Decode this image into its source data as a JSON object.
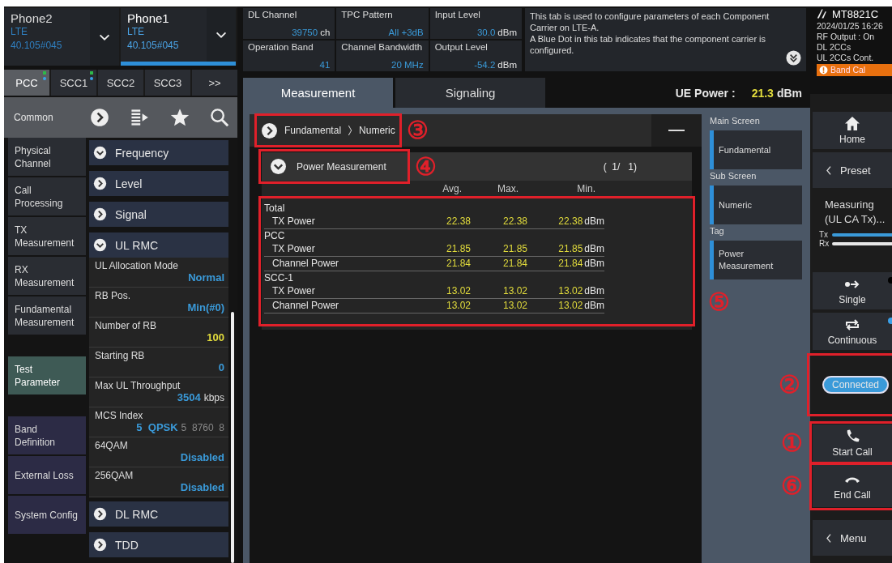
{
  "phones": [
    {
      "name": "Phone2",
      "standard": "LTE",
      "version": "40.105#045",
      "selected": false
    },
    {
      "name": "Phone1",
      "standard": "LTE",
      "version": "40.105#045",
      "selected": true
    }
  ],
  "carrier_tabs": [
    {
      "label": "PCC",
      "selected": true,
      "configured": true,
      "active": true
    },
    {
      "label": "SCC1",
      "selected": false,
      "configured": true,
      "active": true
    },
    {
      "label": "SCC2",
      "selected": false,
      "configured": false,
      "active": false
    },
    {
      "label": "SCC3",
      "selected": false,
      "configured": false,
      "active": false
    },
    {
      "label": ">>",
      "selected": false,
      "configured": false,
      "active": false
    }
  ],
  "header_params": [
    {
      "label": "DL Channel",
      "value": "39750",
      "unit": "ch"
    },
    {
      "label": "TPC Pattern",
      "value": "All +3dB"
    },
    {
      "label": "Input Level",
      "value": "30.0",
      "unit": "dBm"
    },
    {
      "label": "Operation Band",
      "value": "41"
    },
    {
      "label": "Channel Bandwidth",
      "value": "20 MHz"
    },
    {
      "label": "Output Level",
      "value": "-54.2",
      "unit": "dBm"
    }
  ],
  "help_text": [
    "This tab is used to configure parameters of each Component Carrier on LTE-A.",
    "A Blue Dot in this tab indicates that the component carrier is configured."
  ],
  "common": {
    "label": "Common"
  },
  "nav": [
    {
      "label": "Physical Channel",
      "kind": "main",
      "selected": false
    },
    {
      "label": "Call Processing",
      "kind": "main",
      "selected": false
    },
    {
      "label": "TX Measurement",
      "kind": "main",
      "selected": false
    },
    {
      "label": "RX Measurement",
      "kind": "main",
      "selected": false
    },
    {
      "label": "Fundamental Measurement",
      "kind": "main",
      "selected": false
    },
    {
      "label": "Test Parameter",
      "kind": "test",
      "selected": true
    },
    {
      "label": "Band Definition",
      "kind": "system",
      "selected": false
    },
    {
      "label": "External Loss",
      "kind": "system",
      "selected": false
    },
    {
      "label": "System Config",
      "kind": "system",
      "selected": false
    }
  ],
  "sections": [
    {
      "title": "Frequency",
      "expanded": true
    },
    {
      "title": "Level",
      "expanded": false
    },
    {
      "title": "Signal",
      "expanded": false
    },
    {
      "title": "UL RMC",
      "expanded": true,
      "rows": [
        {
          "label": "UL Allocation Mode",
          "value": "Normal",
          "color": "#3a9ad9"
        },
        {
          "label": "RB Pos.",
          "value": "Min(#0)",
          "color": "#3a9ad9"
        },
        {
          "label": "Number of RB",
          "value": "100",
          "color": "#e2dc3c"
        },
        {
          "label": "Starting RB",
          "value": "0",
          "color": "#3a9ad9"
        },
        {
          "label": "Max UL Throughput",
          "value": "3504",
          "unit": "kbps",
          "color": "#3a9ad9"
        },
        {
          "label": "MCS Index",
          "value": "5  QPSK",
          "extra": "5  8760  8",
          "color": "#3a9ad9"
        },
        {
          "label": "64QAM",
          "value": "Disabled",
          "color": "#3a9ad9"
        },
        {
          "label": "256QAM",
          "value": "Disabled",
          "color": "#3a9ad9"
        }
      ]
    },
    {
      "title": "DL RMC",
      "expanded": false
    },
    {
      "title": "TDD",
      "expanded": false
    }
  ],
  "tabs": [
    {
      "label": "Measurement",
      "selected": true
    },
    {
      "label": "Signaling",
      "selected": false
    }
  ],
  "ue_power": {
    "label": "UE Power :",
    "value": "21.3",
    "unit": "dBm"
  },
  "breadcrumb": {
    "items": [
      "Fundamental",
      "Numeric"
    ],
    "callout": "③"
  },
  "result_block": {
    "title": "Power Measurement",
    "expanded": true,
    "page": "(  1/   1)",
    "callout": "④"
  },
  "results": {
    "columns": [
      "Avg.",
      "Max.",
      "Min."
    ],
    "callout": "⑤",
    "groups": [
      {
        "name": "Total",
        "rows": [
          {
            "label": "TX Power",
            "values": [
              "22.38",
              "22.38",
              "22.38"
            ],
            "unit": "dBm"
          }
        ]
      },
      {
        "name": "PCC",
        "rows": [
          {
            "label": "TX Power",
            "values": [
              "21.85",
              "21.85",
              "21.85"
            ],
            "unit": "dBm"
          },
          {
            "label": "Channel Power",
            "values": [
              "21.84",
              "21.84",
              "21.84"
            ],
            "unit": "dBm"
          }
        ]
      },
      {
        "name": "SCC-1",
        "rows": [
          {
            "label": "TX Power",
            "values": [
              "13.02",
              "13.02",
              "13.02"
            ],
            "unit": "dBm"
          },
          {
            "label": "Channel Power",
            "values": [
              "13.02",
              "13.02",
              "13.02"
            ],
            "unit": "dBm"
          }
        ]
      }
    ]
  },
  "screen_list": [
    {
      "heading": "Main Screen",
      "item": "Fundamental"
    },
    {
      "heading": "Sub Screen",
      "item": "Numeric"
    },
    {
      "heading": "Tag",
      "item": "Power Measurement"
    }
  ],
  "instrument": {
    "model": "MT8821C",
    "lines": [
      "2024/01/25 16:26",
      "RF Output : On",
      "DL 2CCs",
      "UL 2CCs Cont."
    ],
    "badge": "Band Cal"
  },
  "controls": [
    {
      "kind": "home",
      "label": "Home"
    },
    {
      "kind": "preset",
      "label": "Preset"
    },
    {
      "kind": "status",
      "label": "Measuring (UL CA Tx)...",
      "indicators": [
        {
          "label": "Tx",
          "color": "#3a9ad9"
        },
        {
          "label": "Rx",
          "color": "#e6e6e6"
        }
      ]
    },
    {
      "kind": "single",
      "label": "Single",
      "selected": false
    },
    {
      "kind": "continuous",
      "label": "Continuous",
      "selected": true
    },
    {
      "kind": "connection",
      "label": "Connected",
      "callout": "②"
    },
    {
      "kind": "start_call",
      "label": "Start Call",
      "callout": "①"
    },
    {
      "kind": "end_call",
      "label": "End Call",
      "callout": "⑥"
    },
    {
      "kind": "menu",
      "label": "Menu"
    }
  ]
}
